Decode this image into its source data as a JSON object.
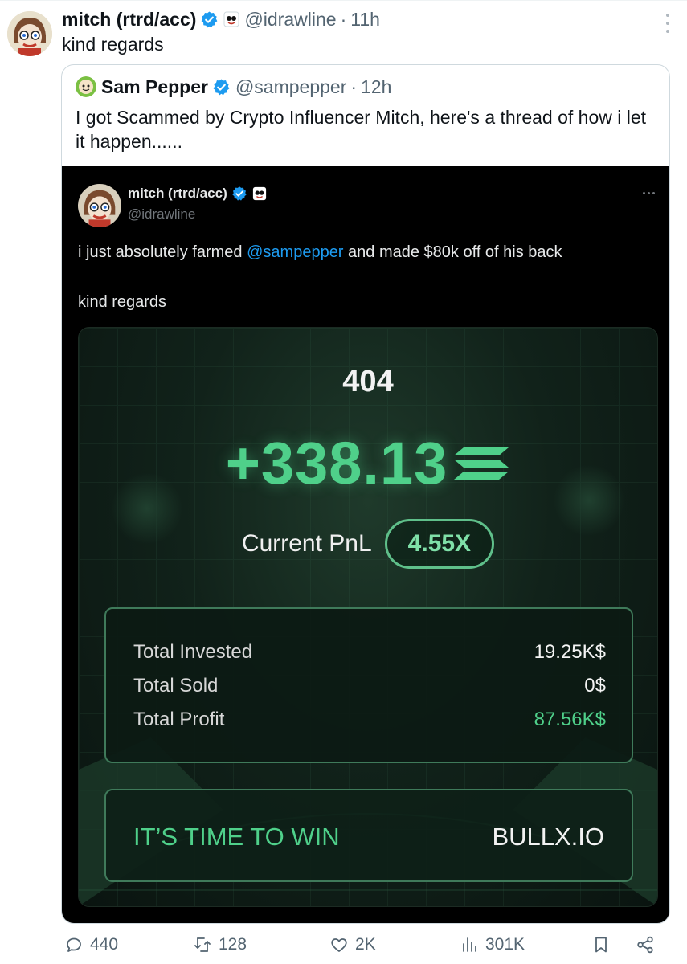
{
  "tweet": {
    "author_name": "mitch (rtrd/acc)",
    "handle": "@idrawline",
    "separator": "·",
    "time": "11h",
    "text": "kind regards",
    "icons": [
      "verified-badge-icon",
      "more-options-icon"
    ]
  },
  "quoted_tweet": {
    "author_name": "Sam Pepper",
    "handle": "@sampepper",
    "separator": "·",
    "time": "12h",
    "text": "I got Scammed by Crypto Influencer Mitch, here's a thread of how i let it happen......"
  },
  "embedded_screenshot": {
    "author_name": "mitch (rtrd/acc)",
    "handle": "@idrawline",
    "text_before": "i just absolutely farmed ",
    "mention": "@sampepper",
    "text_after": " and made $80k off of his back",
    "text_second": "kind regards"
  },
  "pnl_card": {
    "token_name": "404",
    "pnl_value": "+338.13",
    "currency_icon": "solana-icon",
    "pnl_label": "Current PnL",
    "multiplier": "4.55X",
    "stats": [
      {
        "label": "Total Invested",
        "value": "19.25K$"
      },
      {
        "label": "Total Sold",
        "value": "0$"
      },
      {
        "label": "Total Profit",
        "value": "87.56K$"
      }
    ],
    "banner_left": "IT’S TIME TO WIN",
    "banner_right": "BULLX.IO",
    "accent_color": "#4fd08a"
  },
  "actions": {
    "reply_count": "440",
    "retweet_count": "128",
    "like_count": "2K",
    "view_count": "301K"
  },
  "colors": {
    "verified_blue": "#1d9bf0",
    "secondary_text": "#536471",
    "border": "#cfd9de"
  }
}
